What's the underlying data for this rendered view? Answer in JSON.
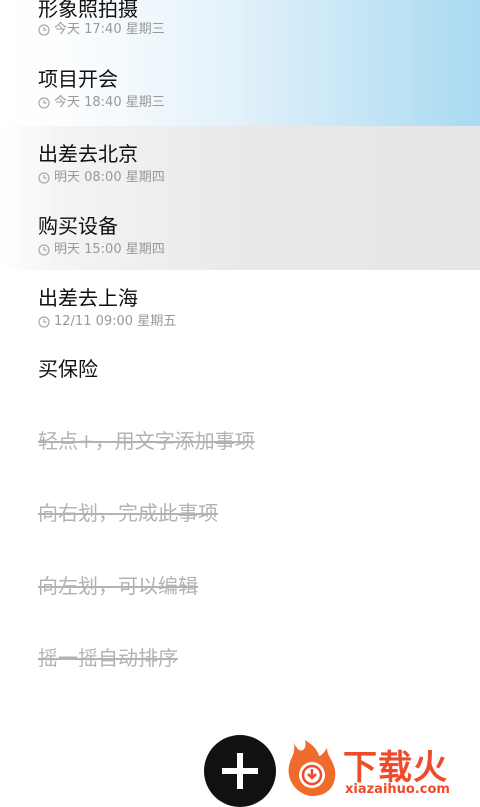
{
  "tasks": [
    {
      "title": "形象照拍摄",
      "time": "今天 17:40 星期三"
    },
    {
      "title": "项目开会",
      "time": "今天 18:40 星期三"
    },
    {
      "title": "出差去北京",
      "time": "明天 08:00 星期四"
    },
    {
      "title": "购买设备",
      "time": "明天 15:00 星期四"
    },
    {
      "title": "出差去上海",
      "time": "12/11 09:00 星期五"
    },
    {
      "title": "买保险"
    }
  ],
  "hints": [
    "轻点+，用文字添加事项",
    "向右划，完成此事项",
    "向左划，可以编辑",
    "摇一摇自动排序"
  ],
  "fab": {
    "icon": "plus-icon"
  },
  "watermark": {
    "brand": "下载火",
    "url": "xiazaihuo.com"
  },
  "colors": {
    "fab": "#111111",
    "watermark": "#ef4b2a",
    "highlight_blue": "#a9daf1",
    "highlight_gray": "#e6e6e6"
  }
}
